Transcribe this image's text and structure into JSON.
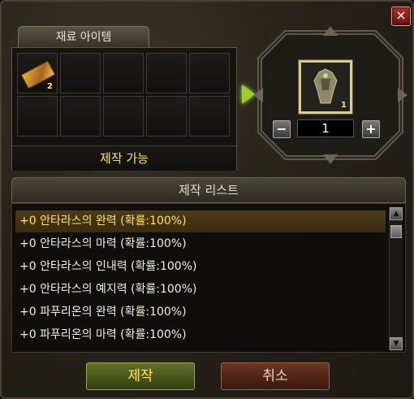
{
  "window": {
    "close_label": "×"
  },
  "materials": {
    "tab_label": "재료 아이템",
    "slots": [
      {
        "item": "ticket-icon",
        "count": "2"
      },
      {},
      {},
      {},
      {},
      {},
      {},
      {},
      {},
      {}
    ],
    "status": "제작 가능"
  },
  "result": {
    "count": "1",
    "quantity": "1",
    "minus_label": "−",
    "plus_label": "+"
  },
  "craft_list": {
    "header": "제작 리스트",
    "items": [
      "+0 안타라스의 완력 (확률:100%)",
      "+0 안타라스의 마력 (확률:100%)",
      "+0 안타라스의 인내력 (확률:100%)",
      "+0 안타라스의 예지력 (확률:100%)",
      "+0 파푸리온의 완력 (확률:100%)",
      "+0 파푸리온의 마력 (확률:100%)"
    ],
    "selected_index": 0
  },
  "buttons": {
    "craft": "제작",
    "cancel": "취소"
  },
  "colors": {
    "highlight": "#ffe256",
    "accent_green": "#9ad12a"
  }
}
